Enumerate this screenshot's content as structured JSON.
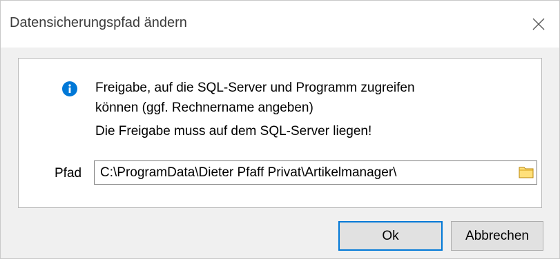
{
  "window": {
    "title": "Datensicherungspfad ändern"
  },
  "message": {
    "line1": "Freigabe, auf die SQL-Server und Programm zugreifen",
    "line2": "können (ggf. Rechnername angeben)",
    "line3": "Die Freigabe muss auf dem SQL-Server liegen!"
  },
  "path": {
    "label": "Pfad",
    "value": "C:\\ProgramData\\Dieter Pfaff Privat\\Artikelmanager\\"
  },
  "buttons": {
    "ok_label": "Ok",
    "cancel_label": "Abbrechen"
  },
  "icons": {
    "info": "info-icon",
    "close": "close-icon",
    "folder": "folder-icon"
  },
  "colors": {
    "info_blue": "#0078d7",
    "focus_border": "#0078d7",
    "folder_yellow": "#ffe07a"
  }
}
